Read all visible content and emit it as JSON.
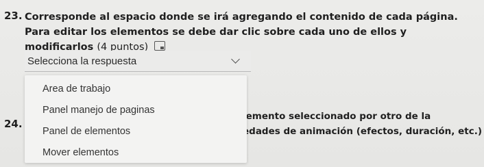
{
  "question23": {
    "number": "23.",
    "text": "Corresponde al espacio donde se irá agregando el contenido de cada página. Para editar los elementos se debe dar clic sobre cada uno de ellos y modificarlos",
    "points": "(4 puntos)",
    "icon": "image-icon"
  },
  "select": {
    "placeholder": "Selecciona la respuesta",
    "options": [
      "Area de trabajo",
      "Panel manejo de paginas",
      "Panel de elementos",
      "Mover elementos"
    ]
  },
  "question24": {
    "number": "24.",
    "partial_line1": "lemento seleccionado por otro de la",
    "partial_line2": "edades de animación (efectos, duración, etc.)"
  }
}
